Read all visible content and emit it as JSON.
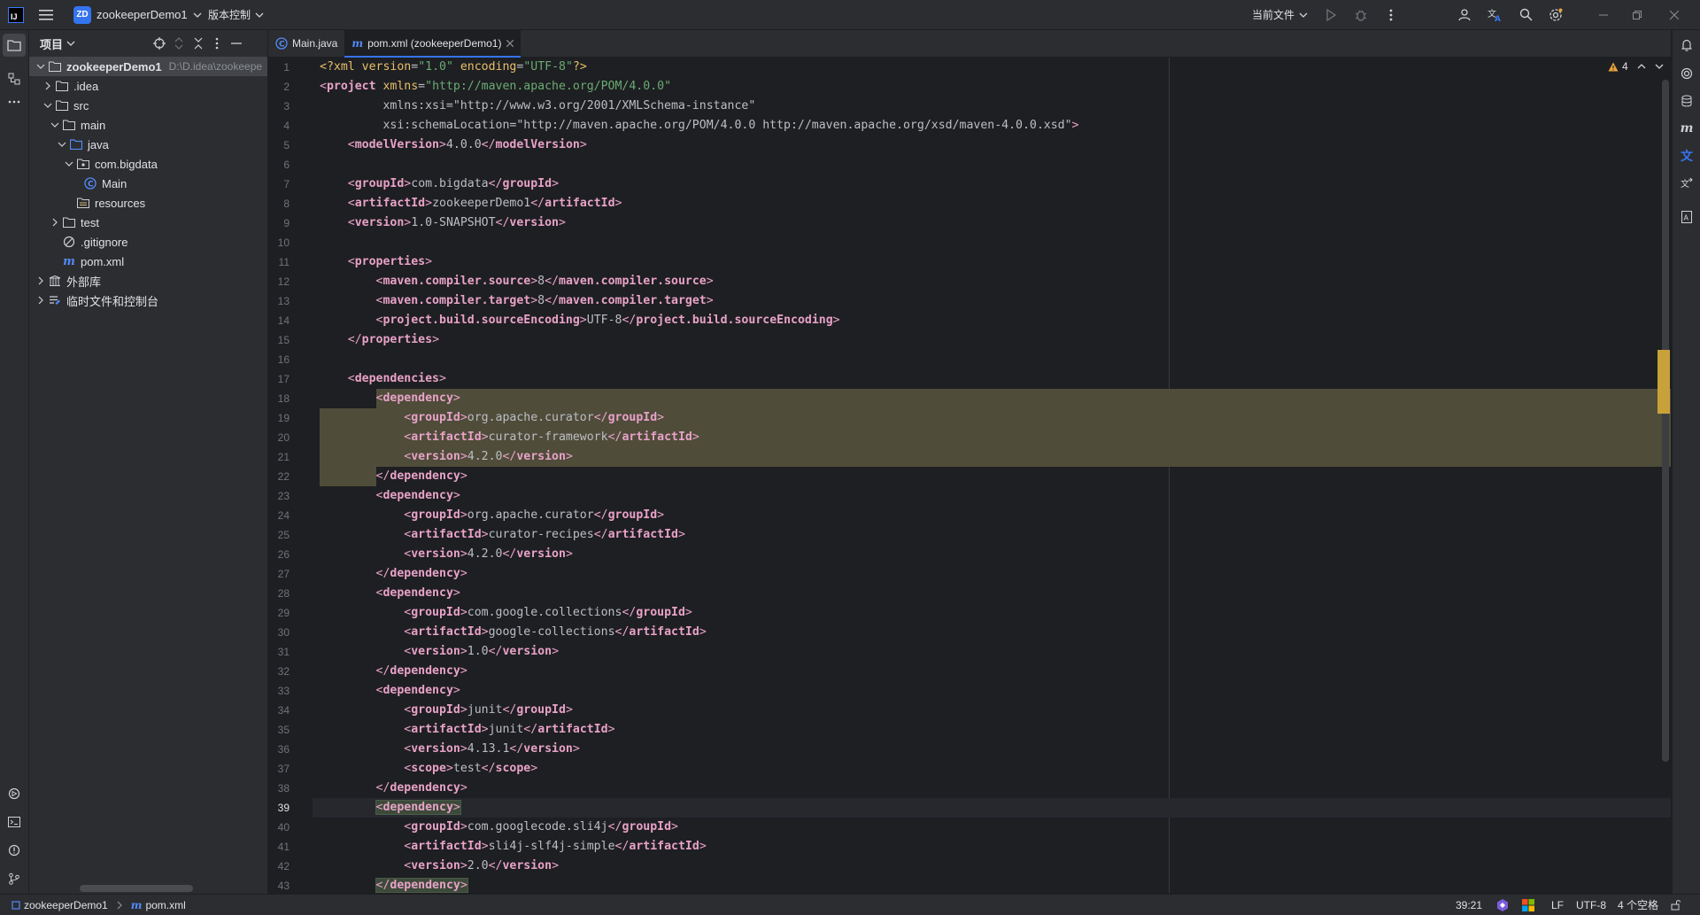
{
  "titlebar": {
    "logo_text": "IJ",
    "project_badge": "ZD",
    "project_name": "zookeeperDemo1",
    "vcs_label": "版本控制",
    "run_config": "当前文件"
  },
  "project_panel": {
    "title": "项目",
    "tree": [
      {
        "label": "zookeeperDemo1",
        "path": "D:\\D.idea\\zookeepe",
        "icon": "folder-icon",
        "expanded": true,
        "level": 0
      },
      {
        "label": ".idea",
        "icon": "folder-icon",
        "expanded": false,
        "level": 1
      },
      {
        "label": "src",
        "icon": "folder-icon",
        "expanded": true,
        "level": 1
      },
      {
        "label": "main",
        "icon": "folder-icon",
        "expanded": true,
        "level": 2
      },
      {
        "label": "java",
        "icon": "source-folder-icon",
        "expanded": true,
        "level": 3
      },
      {
        "label": "com.bigdata",
        "icon": "package-icon",
        "expanded": true,
        "level": 4
      },
      {
        "label": "Main",
        "icon": "java-class-icon",
        "level": 5
      },
      {
        "label": "resources",
        "icon": "resources-folder-icon",
        "level": 4
      },
      {
        "label": "test",
        "icon": "folder-icon",
        "expanded": false,
        "level": 2
      },
      {
        "label": ".gitignore",
        "icon": "ignore-file-icon",
        "level": 2
      },
      {
        "label": "pom.xml",
        "icon": "maven-file-icon",
        "level": 2
      },
      {
        "label": "外部库",
        "icon": "library-icon",
        "expanded": false,
        "level": 0
      },
      {
        "label": "临时文件和控制台",
        "icon": "scratches-icon",
        "expanded": false,
        "level": 0
      }
    ]
  },
  "tabs": [
    {
      "label": "Main.java",
      "icon": "java-class-icon",
      "active": false
    },
    {
      "label": "pom.xml (zookeeperDemo1)",
      "icon": "maven-file-icon",
      "active": true
    }
  ],
  "editor": {
    "warnings_count": "4",
    "current_line": 39,
    "lines": [
      "<?xml version=\"1.0\" encoding=\"UTF-8\"?>",
      "<project xmlns=\"http://maven.apache.org/POM/4.0.0\"",
      "         xmlns:xsi=\"http://www.w3.org/2001/XMLSchema-instance\"",
      "         xsi:schemaLocation=\"http://maven.apache.org/POM/4.0.0 http://maven.apache.org/xsd/maven-4.0.0.xsd\">",
      "    <modelVersion>4.0.0</modelVersion>",
      "",
      "    <groupId>com.bigdata</groupId>",
      "    <artifactId>zookeeperDemo1</artifactId>",
      "    <version>1.0-SNAPSHOT</version>",
      "",
      "    <properties>",
      "        <maven.compiler.source>8</maven.compiler.source>",
      "        <maven.compiler.target>8</maven.compiler.target>",
      "        <project.build.sourceEncoding>UTF-8</project.build.sourceEncoding>",
      "    </properties>",
      "",
      "    <dependencies>",
      "        <dependency>",
      "            <groupId>org.apache.curator</groupId>",
      "            <artifactId>curator-framework</artifactId>",
      "            <version>4.2.0</version>",
      "        </dependency>",
      "        <dependency>",
      "            <groupId>org.apache.curator</groupId>",
      "            <artifactId>curator-recipes</artifactId>",
      "            <version>4.2.0</version>",
      "        </dependency>",
      "        <dependency>",
      "            <groupId>com.google.collections</groupId>",
      "            <artifactId>google-collections</artifactId>",
      "            <version>1.0</version>",
      "        </dependency>",
      "        <dependency>",
      "            <groupId>junit</groupId>",
      "            <artifactId>junit</artifactId>",
      "            <version>4.13.1</version>",
      "            <scope>test</scope>",
      "        </dependency>",
      "        <dependency>",
      "            <groupId>com.googlecode.sli4j</groupId>",
      "            <artifactId>sli4j-slf4j-simple</artifactId>",
      "            <version>2.0</version>",
      "        </dependency>"
    ]
  },
  "statusbar": {
    "breadcrumb_project": "zookeeperDemo1",
    "breadcrumb_file": "pom.xml",
    "position": "39:21",
    "line_ending": "LF",
    "encoding": "UTF-8",
    "indent": "4 个空格"
  },
  "colors": {
    "accent": "#3574f0",
    "highlight_block": "#4f4c3a",
    "warning": "#e8a33d"
  }
}
